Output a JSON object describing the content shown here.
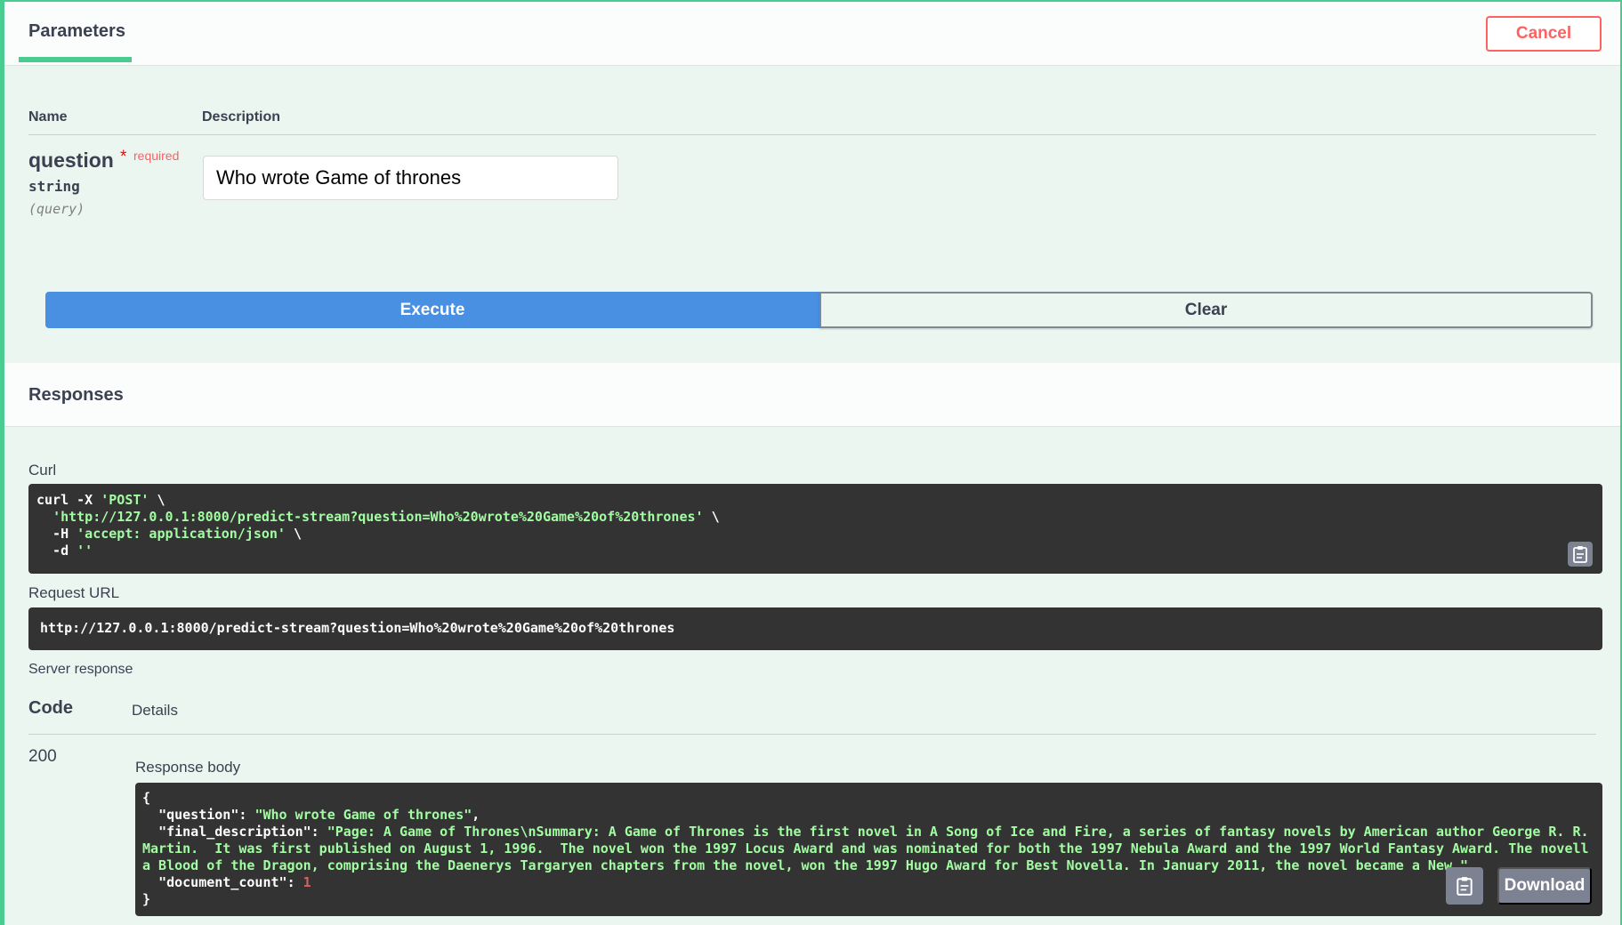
{
  "header": {
    "tab_label": "Parameters",
    "cancel_label": "Cancel"
  },
  "params_table": {
    "col_name": "Name",
    "col_description": "Description",
    "param": {
      "name": "question",
      "required_star": "*",
      "required_label": "required",
      "type": "string",
      "location": "(query)",
      "value": "Who wrote Game of thrones"
    }
  },
  "actions": {
    "execute_label": "Execute",
    "clear_label": "Clear"
  },
  "responses": {
    "title": "Responses",
    "curl_label": "Curl",
    "curl": {
      "l1_cmd": "curl -X ",
      "l1_str": "'POST'",
      "l1_tail": " \\",
      "l2_pre": "  ",
      "l2_str": "'http://127.0.0.1:8000/predict-stream?question=Who%20wrote%20Game%20of%20thrones'",
      "l2_tail": " \\",
      "l3_pre": "  -H ",
      "l3_str": "'accept: application/json'",
      "l3_tail": " \\",
      "l4_pre": "  -d ",
      "l4_str": "''"
    },
    "request_url_label": "Request URL",
    "request_url": "http://127.0.0.1:8000/predict-stream?question=Who%20wrote%20Game%20of%20thrones",
    "server_response_label": "Server response",
    "code_header": "Code",
    "details_header": "Details",
    "status_code": "200",
    "response_body_label": "Response body",
    "body": {
      "open": "{",
      "question_key": "  \"question\"",
      "question_val": "\"Who wrote Game of thrones\"",
      "final_key": "  \"final_description\"",
      "final_val": "\"Page: A Game of Thrones\\nSummary: A Game of Thrones is the first novel in A Song of Ice and Fire, a series of fantasy novels by American author George R. R. Martin.  It was first published on August 1, 1996.  The novel won the 1997 Locus Award and was nominated for both the 1997 Nebula Award and the 1997 World Fantasy Award. The novella Blood of the Dragon, comprising the Daenerys Targaryen chapters from the novel, won the 1997 Hugo Award for Best Novella. In January 2011, the novel became a New \"",
      "count_key": "  \"document_count\"",
      "count_val": "1",
      "close": "}"
    },
    "download_label": "Download"
  },
  "icons": {
    "copy": "clipboard-icon"
  },
  "colors": {
    "accent_green": "#49cc90",
    "execute_blue": "#4990e2",
    "cancel_red": "#ff6060",
    "code_bg": "#333333",
    "string_green": "#a2fca2"
  }
}
